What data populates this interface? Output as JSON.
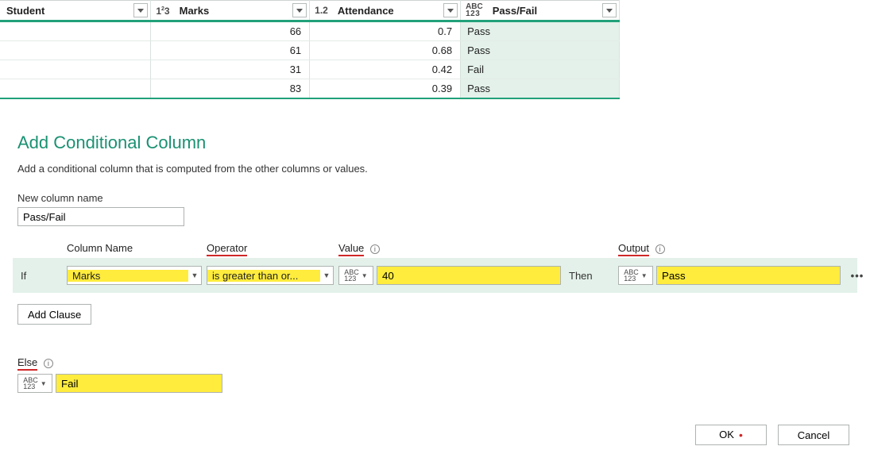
{
  "table": {
    "columns": [
      {
        "label": "Student",
        "type": "",
        "align": "left"
      },
      {
        "label": "Marks",
        "type": "123",
        "align": "right"
      },
      {
        "label": "Attendance",
        "type": "1.2",
        "align": "right"
      },
      {
        "label": "Pass/Fail",
        "type": "ABC123",
        "align": "left",
        "highlight": true
      }
    ],
    "rows": [
      {
        "student": "",
        "marks": "66",
        "attendance": "0.7",
        "passfail": "Pass"
      },
      {
        "student": "",
        "marks": "61",
        "attendance": "0.68",
        "passfail": "Pass"
      },
      {
        "student": "",
        "marks": "31",
        "attendance": "0.42",
        "passfail": "Fail"
      },
      {
        "student": "",
        "marks": "83",
        "attendance": "0.39",
        "passfail": "Pass"
      }
    ]
  },
  "dialog": {
    "title": "Add Conditional Column",
    "subtitle": "Add a conditional column that is computed from the other columns or values.",
    "new_col_label": "New column name",
    "new_col_value": "Pass/Fail",
    "labels": {
      "column": "Column Name",
      "operator": "Operator",
      "value": "Value",
      "output": "Output",
      "if": "If",
      "then": "Then",
      "else": "Else"
    },
    "rule": {
      "column": "Marks",
      "operator": "is greater than or...",
      "value": "40",
      "output": "Pass"
    },
    "else_value": "Fail",
    "add_clause": "Add Clause",
    "ok": "OK",
    "cancel": "Cancel"
  }
}
